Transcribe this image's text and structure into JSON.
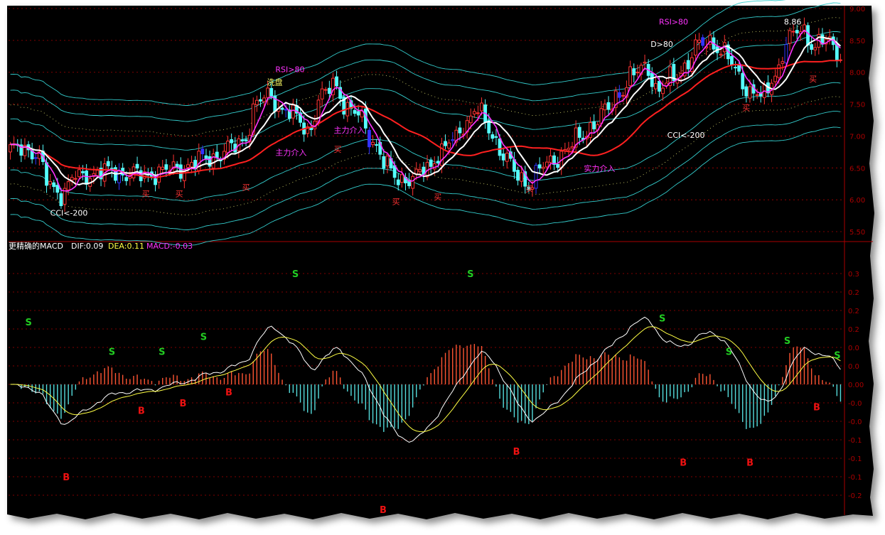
{
  "colors": {
    "background": "#000000",
    "candle_up": "#ff3333",
    "candle_down": "#55ffff",
    "candle_blue": "#3333ff",
    "ma_slow": "#ff2020",
    "ma_mid": "#ff33ff",
    "ma_white": "#ffffff",
    "band": "#33cccc",
    "axis": "#aa0000",
    "macd_pos": "#ff5533",
    "macd_neg": "#55dddd",
    "dif": "#ffffff",
    "dea": "#ffff44",
    "signal_s": "#22cc22",
    "signal_b": "#ee1111",
    "label_magenta": "#ff33ff",
    "label_yellow": "#ffff66",
    "label_red": "#ff3333",
    "label_white": "#ffffff"
  },
  "chart_data": [
    {
      "type": "candlestick",
      "ylim": [
        5.4,
        9.0
      ],
      "y_ticks": [
        "9.00",
        "8.50",
        "8.00",
        "7.50",
        "7.00",
        "6.50",
        "6.00",
        "5.50"
      ],
      "y_tick_values": [
        9.0,
        8.5,
        8.0,
        7.5,
        7.0,
        6.5,
        6.0,
        5.5
      ],
      "price_seed": [
        6.75,
        6.85,
        6.7,
        6.25,
        6.1,
        6.35,
        6.4,
        6.42,
        6.45,
        6.4,
        6.38,
        6.42,
        6.45,
        6.5,
        6.55,
        6.65,
        6.7,
        6.8,
        6.95,
        7.5,
        7.65,
        7.4,
        7.3,
        7.1,
        7.6,
        7.85,
        7.4,
        7.3,
        6.9,
        6.5,
        6.35,
        6.3,
        6.5,
        6.7,
        6.9,
        7.2,
        7.4,
        7.1,
        6.7,
        6.4,
        6.25,
        6.5,
        6.65,
        6.8,
        7.0,
        7.2,
        7.4,
        7.7,
        7.95,
        8.1,
        7.7,
        7.9,
        8.1,
        8.4,
        8.5,
        8.3,
        8.0,
        7.7,
        7.6,
        8.0,
        8.5,
        8.7,
        8.4,
        8.5,
        8.3
      ],
      "annotations": [
        {
          "text": "洗盘",
          "x_frac": 0.31,
          "price": 7.8,
          "color": "label_yellow"
        },
        {
          "text": "RSI>80",
          "x_frac": 0.32,
          "price": 8.0,
          "color": "label_magenta"
        },
        {
          "text": "RSI>80",
          "x_frac": 0.78,
          "price": 8.75,
          "color": "label_magenta"
        },
        {
          "text": "D>80",
          "x_frac": 0.77,
          "price": 8.4,
          "color": "label_white"
        },
        {
          "text": "8.86",
          "x_frac": 0.93,
          "price": 8.75,
          "color": "label_white"
        },
        {
          "text": "主力介入",
          "x_frac": 0.32,
          "price": 6.7,
          "color": "label_magenta"
        },
        {
          "text": "主力介入",
          "x_frac": 0.39,
          "price": 7.05,
          "color": "label_magenta"
        },
        {
          "text": "实力介入",
          "x_frac": 0.69,
          "price": 6.45,
          "color": "label_magenta"
        },
        {
          "text": "CCI<-200",
          "x_frac": 0.05,
          "price": 5.75,
          "color": "label_white"
        },
        {
          "text": "CCI<-200",
          "x_frac": 0.79,
          "price": 6.97,
          "color": "label_white"
        },
        {
          "text": "买",
          "x_frac": 0.16,
          "price": 6.05,
          "color": "label_red"
        },
        {
          "text": "买",
          "x_frac": 0.2,
          "price": 6.05,
          "color": "label_red"
        },
        {
          "text": "买",
          "x_frac": 0.28,
          "price": 6.15,
          "color": "label_red"
        },
        {
          "text": "买",
          "x_frac": 0.39,
          "price": 6.75,
          "color": "label_red"
        },
        {
          "text": "买",
          "x_frac": 0.46,
          "price": 5.93,
          "color": "label_red"
        },
        {
          "text": "买",
          "x_frac": 0.51,
          "price": 6.0,
          "color": "label_red"
        },
        {
          "text": "买",
          "x_frac": 0.62,
          "price": 6.13,
          "color": "label_red"
        },
        {
          "text": "买",
          "x_frac": 0.88,
          "price": 7.4,
          "color": "label_red"
        },
        {
          "text": "买",
          "x_frac": 0.96,
          "price": 7.85,
          "color": "label_red"
        }
      ]
    },
    {
      "type": "bar+line",
      "title": "更精确的MACD",
      "legend": [
        {
          "name": "DIF:0.09",
          "color": "dif"
        },
        {
          "name": "DEA:0.11",
          "color": "dea"
        },
        {
          "name": "MACD:-0.03",
          "color": "label_magenta"
        }
      ],
      "ylim": [
        -0.32,
        0.34
      ],
      "y_ticks": [
        "0.3",
        "0.2",
        "0.2",
        "0.2",
        "0.0",
        "0.0",
        "0.00",
        "-0.0",
        "-0.0",
        "-0.1",
        "-0.1",
        "-0.1",
        "-0.2"
      ],
      "y_tick_values": [
        0.3,
        0.25,
        0.2,
        0.15,
        0.1,
        0.05,
        0.0,
        -0.05,
        -0.1,
        -0.15,
        -0.2,
        -0.25,
        -0.3
      ],
      "signals": [
        {
          "text": "S",
          "x_frac": 0.02,
          "value": 0.16
        },
        {
          "text": "S",
          "x_frac": 0.12,
          "value": 0.08
        },
        {
          "text": "S",
          "x_frac": 0.18,
          "value": 0.08
        },
        {
          "text": "S",
          "x_frac": 0.23,
          "value": 0.12
        },
        {
          "text": "S",
          "x_frac": 0.34,
          "value": 0.29
        },
        {
          "text": "S",
          "x_frac": 0.55,
          "value": 0.29
        },
        {
          "text": "S",
          "x_frac": 0.78,
          "value": 0.17
        },
        {
          "text": "S",
          "x_frac": 0.86,
          "value": 0.08
        },
        {
          "text": "S",
          "x_frac": 0.93,
          "value": 0.11
        },
        {
          "text": "S",
          "x_frac": 0.99,
          "value": 0.07
        },
        {
          "text": "B",
          "x_frac": 0.065,
          "value": -0.26
        },
        {
          "text": "B",
          "x_frac": 0.155,
          "value": -0.08
        },
        {
          "text": "B",
          "x_frac": 0.205,
          "value": -0.06
        },
        {
          "text": "B",
          "x_frac": 0.26,
          "value": -0.03
        },
        {
          "text": "B",
          "x_frac": 0.445,
          "value": -0.35
        },
        {
          "text": "B",
          "x_frac": 0.605,
          "value": -0.19
        },
        {
          "text": "B",
          "x_frac": 0.805,
          "value": -0.22
        },
        {
          "text": "B",
          "x_frac": 0.885,
          "value": -0.22
        },
        {
          "text": "B",
          "x_frac": 0.965,
          "value": -0.07
        }
      ]
    }
  ]
}
